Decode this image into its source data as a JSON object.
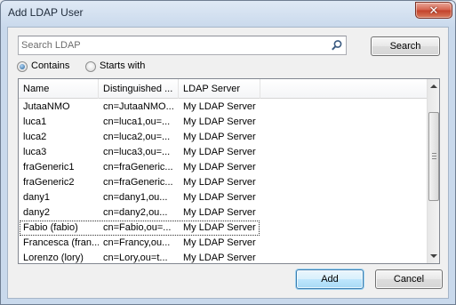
{
  "window": {
    "title": "Add LDAP User",
    "close_glyph": "✕"
  },
  "search": {
    "placeholder": "Search LDAP",
    "value": "",
    "icon": "search-icon",
    "button_label": "Search"
  },
  "match_mode": {
    "options": [
      {
        "label": "Contains",
        "checked": true
      },
      {
        "label": "Starts with",
        "checked": false
      }
    ]
  },
  "users_list": {
    "columns": [
      "Name",
      "Distinguished ...",
      "LDAP Server"
    ],
    "rows": [
      [
        "JutaaNMO",
        "cn=JutaaNMO...",
        "My LDAP Server"
      ],
      [
        "luca1",
        "cn=luca1,ou=...",
        "My LDAP Server"
      ],
      [
        "luca2",
        "cn=luca2,ou=...",
        "My LDAP Server"
      ],
      [
        "luca3",
        "cn=luca3,ou=...",
        "My LDAP Server"
      ],
      [
        "fraGeneric1",
        "cn=fraGeneric...",
        "My LDAP Server"
      ],
      [
        "fraGeneric2",
        "cn=fraGeneric...",
        "My LDAP Server"
      ],
      [
        "dany1",
        "cn=dany1,ou...",
        "My LDAP Server"
      ],
      [
        "dany2",
        "cn=dany2,ou...",
        "My LDAP Server"
      ],
      [
        "Fabio (fabio)",
        "cn=Fabio,ou=...",
        "My LDAP Server"
      ],
      [
        "Francesca (fran...",
        "cn=Francy,ou...",
        "My LDAP Server"
      ],
      [
        "Lorenzo (lory)",
        "cn=Lory,ou=t...",
        "My LDAP Server"
      ]
    ],
    "focused_row": 8
  },
  "footer": {
    "add_label": "Add",
    "cancel_label": "Cancel"
  }
}
